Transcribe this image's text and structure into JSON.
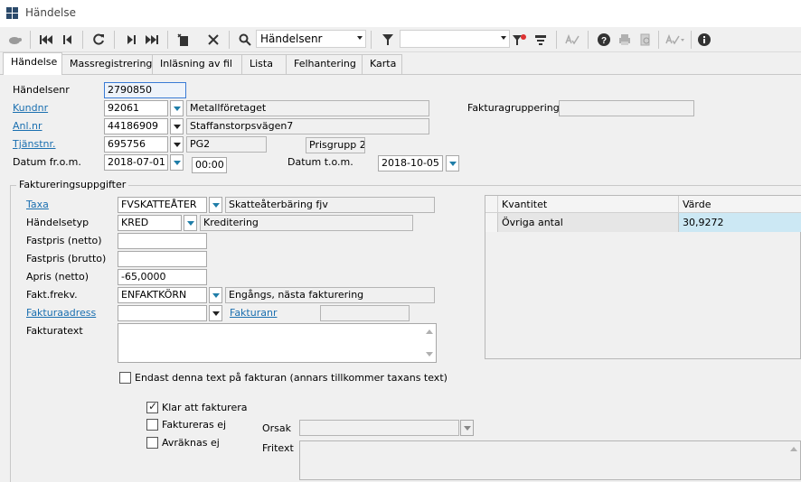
{
  "window": {
    "title": "Händelse"
  },
  "toolbar": {
    "search_field": "Händelsenr",
    "filter_value": ""
  },
  "tabs": [
    "Händelse",
    "Massregistrering",
    "Inläsning av fil",
    "Lista",
    "Felhantering",
    "Karta"
  ],
  "form": {
    "handelsenr": {
      "label": "Händelsenr",
      "value": "2790850"
    },
    "kundnr": {
      "label": "Kundnr",
      "value": "92061",
      "name": "Metallföretaget"
    },
    "anlnr": {
      "label": "Anl.nr",
      "value": "44186909",
      "name": "Staffanstorpsvägen7"
    },
    "tjanstnr": {
      "label": "Tjänstnr.",
      "value": "695756",
      "name": "PG2",
      "prisgrupp": "Prisgrupp 2"
    },
    "datum_from": {
      "label": "Datum fr.o.m.",
      "value": "2018-07-01",
      "time": "00:00"
    },
    "datum_tom": {
      "label": "Datum t.o.m.",
      "value": "2018-10-05"
    },
    "fakturagruppering": {
      "label": "Fakturagruppering",
      "value": ""
    }
  },
  "fakturering": {
    "title": "Faktureringsuppgifter",
    "taxa": {
      "label": "Taxa",
      "value": "FVSKATTEÅTER",
      "name": "Skatteåterbäring fjv"
    },
    "handelsetyp": {
      "label": "Händelsetyp",
      "value": "KRED",
      "name": "Kreditering"
    },
    "fastpris_netto": {
      "label": "Fastpris (netto)",
      "value": ""
    },
    "fastpris_brutto": {
      "label": "Fastpris (brutto)",
      "value": ""
    },
    "apris_netto": {
      "label": "Apris (netto)",
      "value": "-65,0000"
    },
    "fakt_frekv": {
      "label": "Fakt.frekv.",
      "value": "ENFAKTKÖRN",
      "name": "Engångs, nästa fakturering"
    },
    "fakturaadress": {
      "label": "Fakturaadress",
      "value": ""
    },
    "fakturanr": {
      "label": "Fakturanr",
      "value": ""
    },
    "fakturatext": {
      "label": "Fakturatext",
      "value": ""
    },
    "endast_text": {
      "label": "Endast denna text på fakturan (annars tillkommer taxans text)",
      "checked": false
    },
    "klar_att_fakturera": {
      "label": "Klar att fakturera",
      "checked": true
    },
    "faktureras_ej": {
      "label": "Faktureras ej",
      "checked": false
    },
    "avraknas_ej": {
      "label": "Avräknas ej",
      "checked": false
    },
    "orsak": {
      "label": "Orsak",
      "value": ""
    },
    "fritext": {
      "label": "Fritext",
      "value": ""
    }
  },
  "quantity_grid": {
    "columns": [
      "Kvantitet",
      "Värde"
    ],
    "rows": [
      {
        "kvantitet": "Övriga antal",
        "varde": "30,9272"
      }
    ]
  },
  "colors": {
    "link": "#1a6fb0",
    "selected_row": "#cce8f4",
    "focus_border": "#3a7bd5"
  }
}
